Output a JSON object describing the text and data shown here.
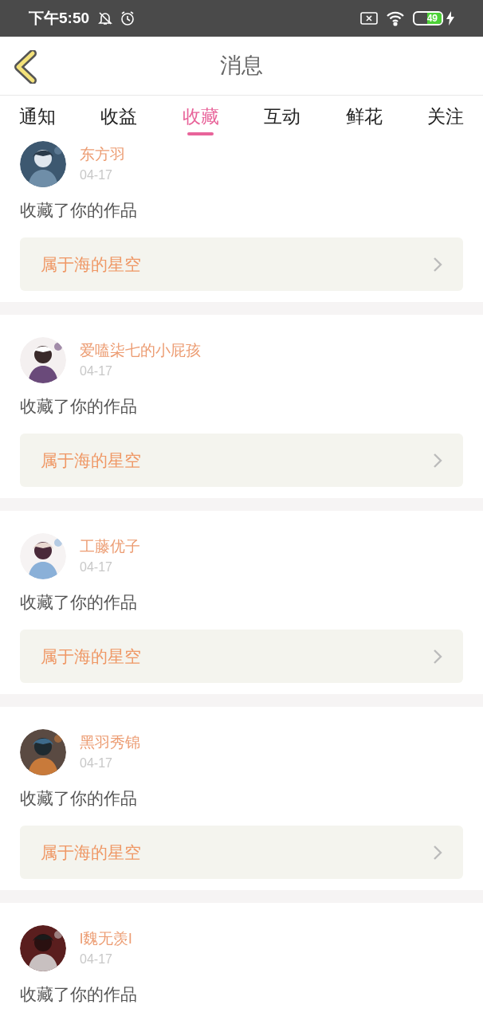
{
  "status_bar": {
    "time": "下午5:50",
    "battery": "49"
  },
  "header": {
    "title": "消息"
  },
  "tabs": [
    {
      "label": "通知",
      "selected": false
    },
    {
      "label": "收益",
      "selected": false
    },
    {
      "label": "收藏",
      "selected": true
    },
    {
      "label": "互动",
      "selected": false
    },
    {
      "label": "鲜花",
      "selected": false
    },
    {
      "label": "关注",
      "selected": false
    }
  ],
  "messages": [
    {
      "user": "东方羽",
      "date": "04-17",
      "text": "收藏了你的作品",
      "work": "属于海的星空"
    },
    {
      "user": "爱嗑柒七的小屁孩",
      "date": "04-17",
      "text": "收藏了你的作品",
      "work": "属于海的星空"
    },
    {
      "user": "工藤优子",
      "date": "04-17",
      "text": "收藏了你的作品",
      "work": "属于海的星空"
    },
    {
      "user": "黑羽秀锦",
      "date": "04-17",
      "text": "收藏了你的作品",
      "work": "属于海的星空"
    },
    {
      "user": "l魏无羡l",
      "date": "04-17",
      "text": "收藏了你的作品"
    }
  ]
}
